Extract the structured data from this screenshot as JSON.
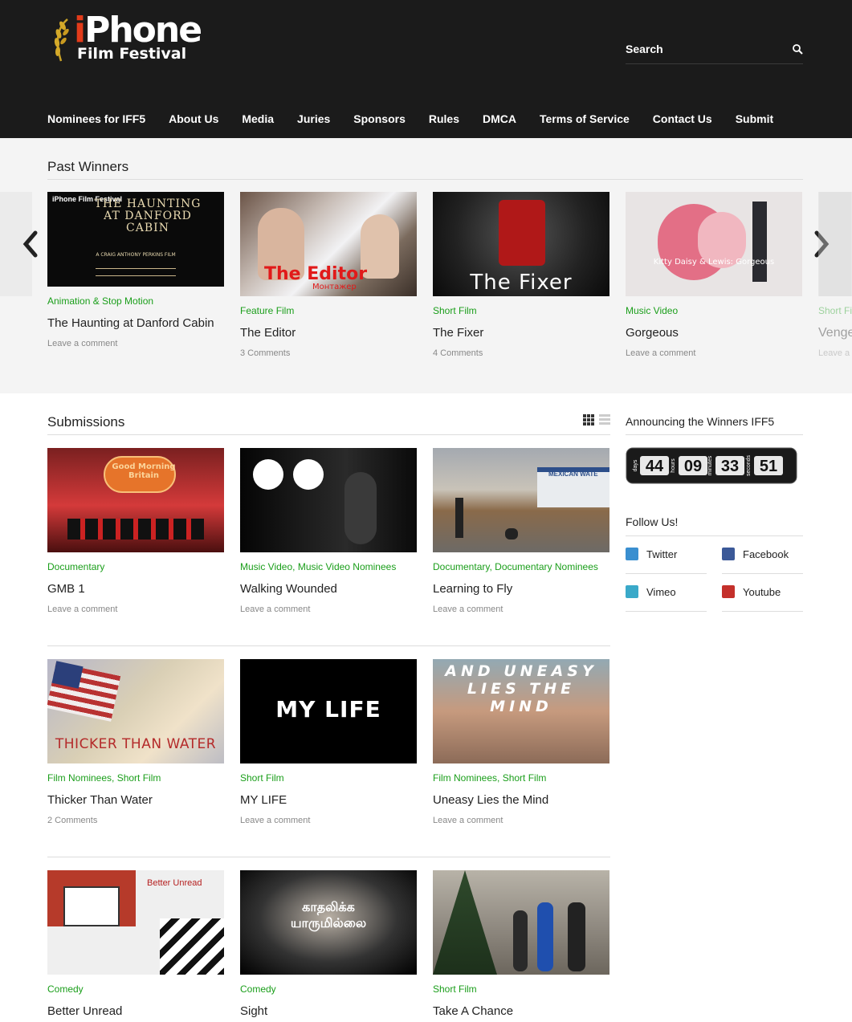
{
  "header": {
    "logo_line1": "iPhone",
    "logo_line2": "Film Festival",
    "search_placeholder": "Search"
  },
  "nav": [
    "Nominees for IFF5",
    "About Us",
    "Media",
    "Juries",
    "Sponsors",
    "Rules",
    "DMCA",
    "Terms of Service",
    "Contact Us",
    "Submit"
  ],
  "past_winners": {
    "title": "Past Winners",
    "items": [
      {
        "category": "Animation & Stop Motion",
        "title": "The Haunting at Danford Cabin",
        "meta": "Leave a comment",
        "thumb_text": "THE HAUNTING AT DANFORD CABIN",
        "thumb_sub": "A CRAIG ANTHONY PERKINS FILM",
        "thumb_brand": "iPhone Film Festival"
      },
      {
        "category": "Feature Film",
        "title": "The Editor",
        "meta": "3 Comments",
        "thumb_text": "The Editor",
        "thumb_sub": "Монтажер"
      },
      {
        "category": "Short Film",
        "title": "The Fixer",
        "meta": "4 Comments",
        "thumb_text": "The Fixer"
      },
      {
        "category": "Music Video",
        "title": "Gorgeous",
        "meta": "Leave a comment",
        "thumb_text": "Kitty Daisy & Lewis: Gorgeous"
      }
    ],
    "partial_next": {
      "category": "Short Fi",
      "title": "Venge",
      "meta": "Leave a"
    }
  },
  "submissions": {
    "title": "Submissions",
    "items": [
      {
        "categories": [
          "Documentary"
        ],
        "title": "GMB 1",
        "meta": "Leave a comment",
        "thumb_text": "Good Morning Britain"
      },
      {
        "categories": [
          "Music Video",
          "Music Video Nominees"
        ],
        "title": "Walking Wounded",
        "meta": "Leave a comment",
        "thumb_text": ""
      },
      {
        "categories": [
          "Documentary",
          "Documentary Nominees"
        ],
        "title": "Learning to Fly",
        "meta": "Leave a comment",
        "thumb_text": "MEXICAN WATE"
      },
      {
        "categories": [
          "Film Nominees",
          "Short Film"
        ],
        "title": "Thicker Than Water",
        "meta": "2 Comments",
        "thumb_text": "THICKER THAN WATER"
      },
      {
        "categories": [
          "Short Film"
        ],
        "title": "MY LIFE",
        "meta": "Leave a comment",
        "thumb_text": "MY LIFE"
      },
      {
        "categories": [
          "Film Nominees",
          "Short Film"
        ],
        "title": "Uneasy Lies the Mind",
        "meta": "Leave a comment",
        "thumb_text": "AND UNEASY LIES THE MIND"
      },
      {
        "categories": [
          "Comedy"
        ],
        "title": "Better Unread",
        "meta": "",
        "thumb_text": "Better Unread"
      },
      {
        "categories": [
          "Comedy"
        ],
        "title": "Sight",
        "meta": "",
        "thumb_text": "காதலிக்க யாருமில்லை"
      },
      {
        "categories": [
          "Short Film"
        ],
        "title": "Take A Chance",
        "meta": "",
        "thumb_text": ""
      }
    ]
  },
  "sidebar": {
    "announce_title": "Announcing the Winners IFF5",
    "countdown": {
      "days": "44",
      "hours": "09",
      "minutes": "33",
      "seconds": "51",
      "days_label": "days",
      "hours_label": "hours",
      "minutes_label": "minutes",
      "seconds_label": "seconds"
    },
    "follow_title": "Follow Us!",
    "social": [
      {
        "label": "Twitter",
        "icon": "twitter-icon",
        "color": "#3a8fd0"
      },
      {
        "label": "Facebook",
        "icon": "facebook-icon",
        "color": "#3b5998"
      },
      {
        "label": "Vimeo",
        "icon": "vimeo-icon",
        "color": "#3aa9c9"
      },
      {
        "label": "Youtube",
        "icon": "youtube-icon",
        "color": "#c4302b"
      }
    ]
  },
  "colors": {
    "accent_green": "#1a9e1a",
    "header_bg": "#1b1b1b",
    "band_bg": "#f4f4f4"
  }
}
